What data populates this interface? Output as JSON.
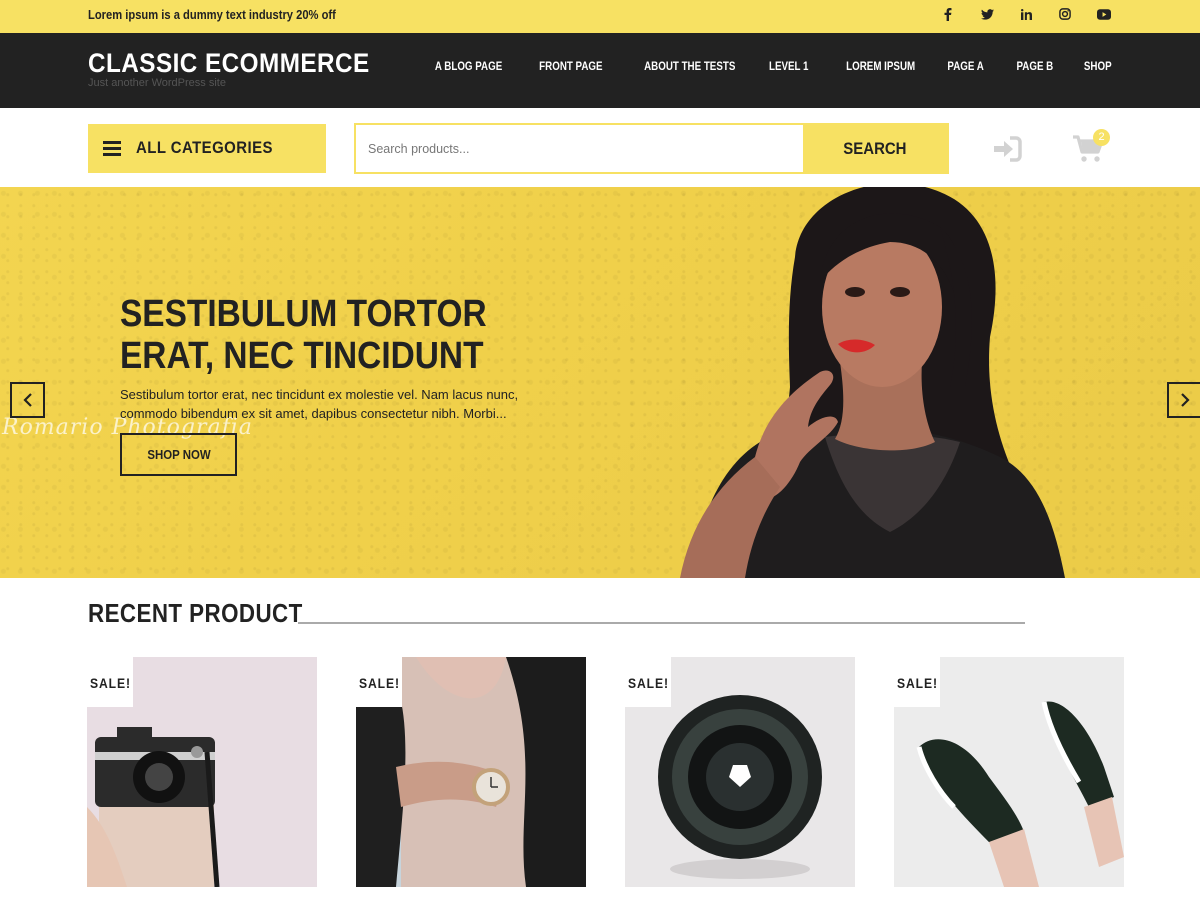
{
  "topbar": {
    "promo": "Lorem ipsum is a dummy text industry 20% off",
    "socials": [
      "facebook-icon",
      "twitter-icon",
      "linkedin-icon",
      "instagram-icon",
      "youtube-icon"
    ]
  },
  "header": {
    "site_title": "CLASSIC ECOMMERCE",
    "tagline": "Just another WordPress site",
    "nav": [
      "A BLOG PAGE",
      "FRONT PAGE",
      "ABOUT THE TESTS",
      "LEVEL 1",
      "LOREM IPSUM",
      "PAGE A",
      "PAGE B",
      "SHOP"
    ]
  },
  "search_row": {
    "categories_label": "ALL CATEGORIES",
    "search_placeholder": "Search products...",
    "search_button": "SEARCH",
    "cart_count": "2"
  },
  "hero": {
    "heading": "SESTIBULUM TORTOR ERAT, NEC TINCIDUNT",
    "description": "Sestibulum tortor erat, nec tincidunt ex molestie vel. Nam lacus nunc, commodo bibendum ex sit amet, dapibus consectetur nibh. Morbi...",
    "button": "SHOP NOW",
    "watermark": "Romario Photografia"
  },
  "recent": {
    "title": "RECENT PRODUCT",
    "products": [
      {
        "badge": "SALE!",
        "image": "camera-in-hand"
      },
      {
        "badge": "SALE!",
        "image": "wrist-watch"
      },
      {
        "badge": "SALE!",
        "image": "camera-lens"
      },
      {
        "badge": "SALE!",
        "image": "sneakers"
      }
    ]
  },
  "colors": {
    "accent": "#f7e163",
    "header_bg": "#222222",
    "text_dark": "#222222"
  }
}
